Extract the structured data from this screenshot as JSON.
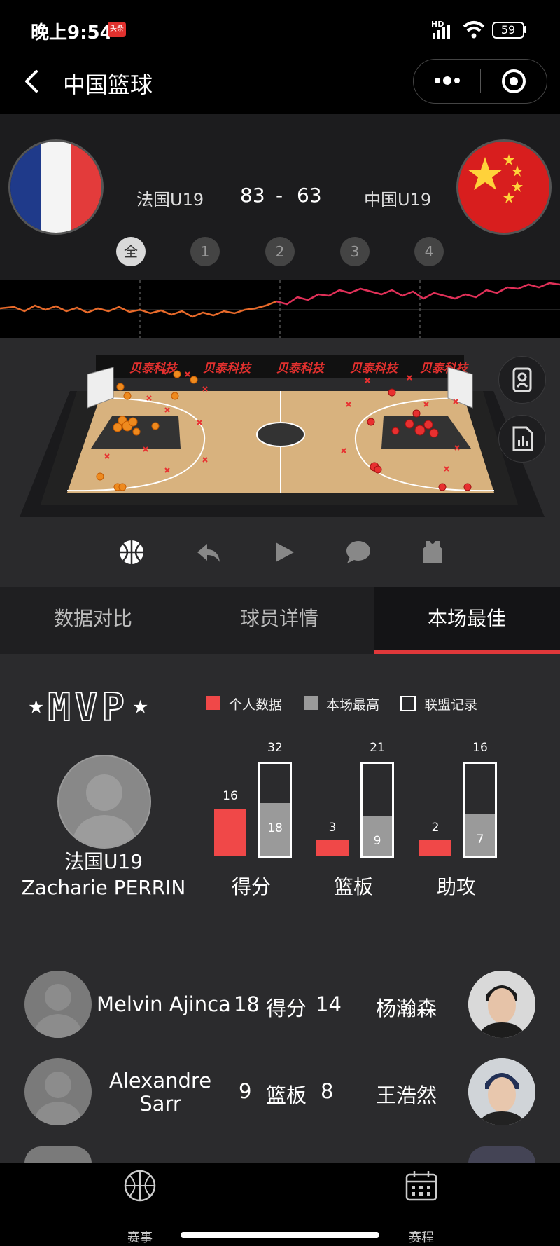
{
  "status": {
    "time": "晚上9:54",
    "badge": "头条",
    "network": "HD",
    "battery": "59"
  },
  "title": "中国篮球",
  "game": {
    "home": {
      "name": "法国U19",
      "score": "83"
    },
    "away": {
      "name": "中国U19",
      "score": "63"
    },
    "separator": "-",
    "periods": [
      "全",
      "1",
      "2",
      "3",
      "4"
    ],
    "active_period": 0
  },
  "court": {
    "ad_text": "贝泰科技"
  },
  "tabs": [
    {
      "label": "数据对比"
    },
    {
      "label": "球员详情"
    },
    {
      "label": "本场最佳"
    }
  ],
  "active_tab": 2,
  "mvp": {
    "title": "MVP",
    "legend": [
      "个人数据",
      "本场最高",
      "联盟记录"
    ],
    "colors": {
      "personal": "#f04848",
      "game_high": "#9a9a9a",
      "league": "#ffffff"
    },
    "team": "法国U19",
    "player": "Zacharie PERRIN",
    "stats": [
      {
        "label": "得分",
        "personal": "16",
        "game_high": "18",
        "league": "32"
      },
      {
        "label": "篮板",
        "personal": "3",
        "game_high": "9",
        "league": "21"
      },
      {
        "label": "助攻",
        "personal": "2",
        "game_high": "7",
        "league": "16"
      }
    ]
  },
  "leaders": [
    {
      "left_name": "Melvin Ajinca",
      "left_value": "18",
      "stat": "得分",
      "right_value": "14",
      "right_name": "杨瀚森"
    },
    {
      "left_name": "Alexandre Sarr",
      "left_value": "9",
      "stat": "篮板",
      "right_value": "8",
      "right_name": "王浩然"
    }
  ],
  "nav": [
    {
      "label": "赛事"
    },
    {
      "label": "赛程"
    }
  ]
}
